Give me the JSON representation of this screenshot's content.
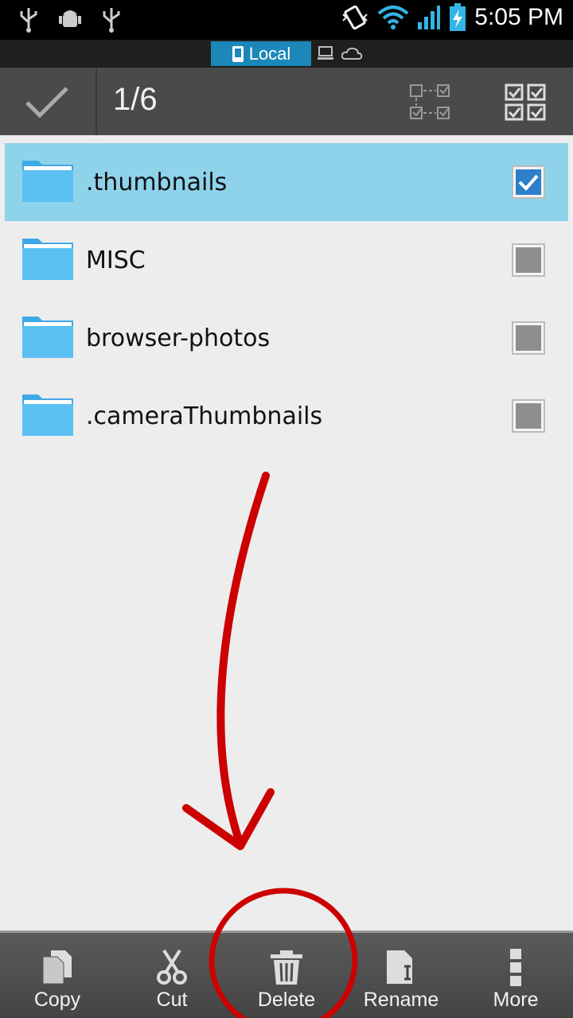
{
  "status_bar": {
    "time": "5:05 PM",
    "icons": [
      "usb-icon",
      "android-debug-icon",
      "usb-icon",
      "vibrate-icon",
      "wifi-icon",
      "signal-icon",
      "battery-charging-icon"
    ]
  },
  "location_tabs": {
    "active_label": "Local",
    "others": [
      "lan-icon",
      "cloud-icon"
    ]
  },
  "selection_bar": {
    "count": "1/6",
    "icons": [
      "done-check-icon",
      "select-range-icon",
      "select-all-icon"
    ]
  },
  "files": [
    {
      "name": ".thumbnails",
      "checked": true
    },
    {
      "name": "MISC",
      "checked": false
    },
    {
      "name": "browser-photos",
      "checked": false
    },
    {
      "name": ".cameraThumbnails",
      "checked": false
    }
  ],
  "toolbar": {
    "copy_label": "Copy",
    "cut_label": "Cut",
    "delete_label": "Delete",
    "rename_label": "Rename",
    "more_label": "More"
  },
  "colors": {
    "accent": "#1c87b9",
    "selected_row": "#8fd3eb",
    "annotation": "#cc0000"
  }
}
